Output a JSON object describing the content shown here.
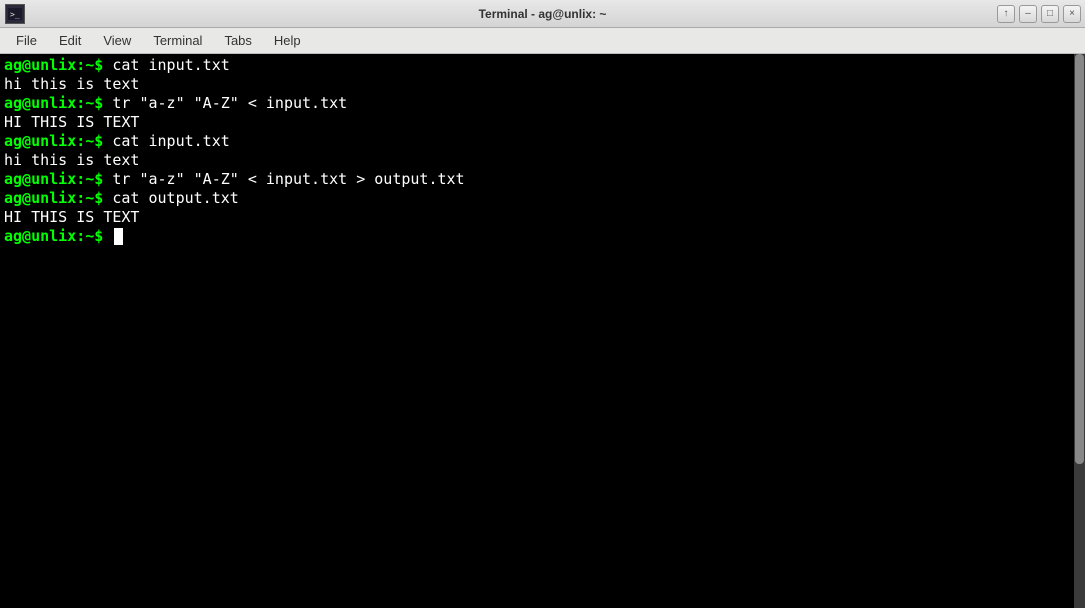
{
  "titlebar": {
    "title": "Terminal - ag@unlix: ~"
  },
  "window_controls": {
    "stick": "↑",
    "minimize": "–",
    "maximize": "□",
    "close": "×"
  },
  "menubar": {
    "items": [
      {
        "label": "File"
      },
      {
        "label": "Edit"
      },
      {
        "label": "View"
      },
      {
        "label": "Terminal"
      },
      {
        "label": "Tabs"
      },
      {
        "label": "Help"
      }
    ]
  },
  "terminal": {
    "prompt": "ag@unlix:~$",
    "lines": [
      {
        "type": "cmd",
        "text": " cat input.txt"
      },
      {
        "type": "out",
        "text": "hi this is text"
      },
      {
        "type": "cmd",
        "text": " tr \"a-z\" \"A-Z\" < input.txt"
      },
      {
        "type": "out",
        "text": "HI THIS IS TEXT"
      },
      {
        "type": "cmd",
        "text": " cat input.txt"
      },
      {
        "type": "out",
        "text": "hi this is text"
      },
      {
        "type": "cmd",
        "text": " tr \"a-z\" \"A-Z\" < input.txt > output.txt"
      },
      {
        "type": "cmd",
        "text": " cat output.txt"
      },
      {
        "type": "out",
        "text": "HI THIS IS TEXT"
      },
      {
        "type": "cursor",
        "text": ""
      }
    ]
  }
}
